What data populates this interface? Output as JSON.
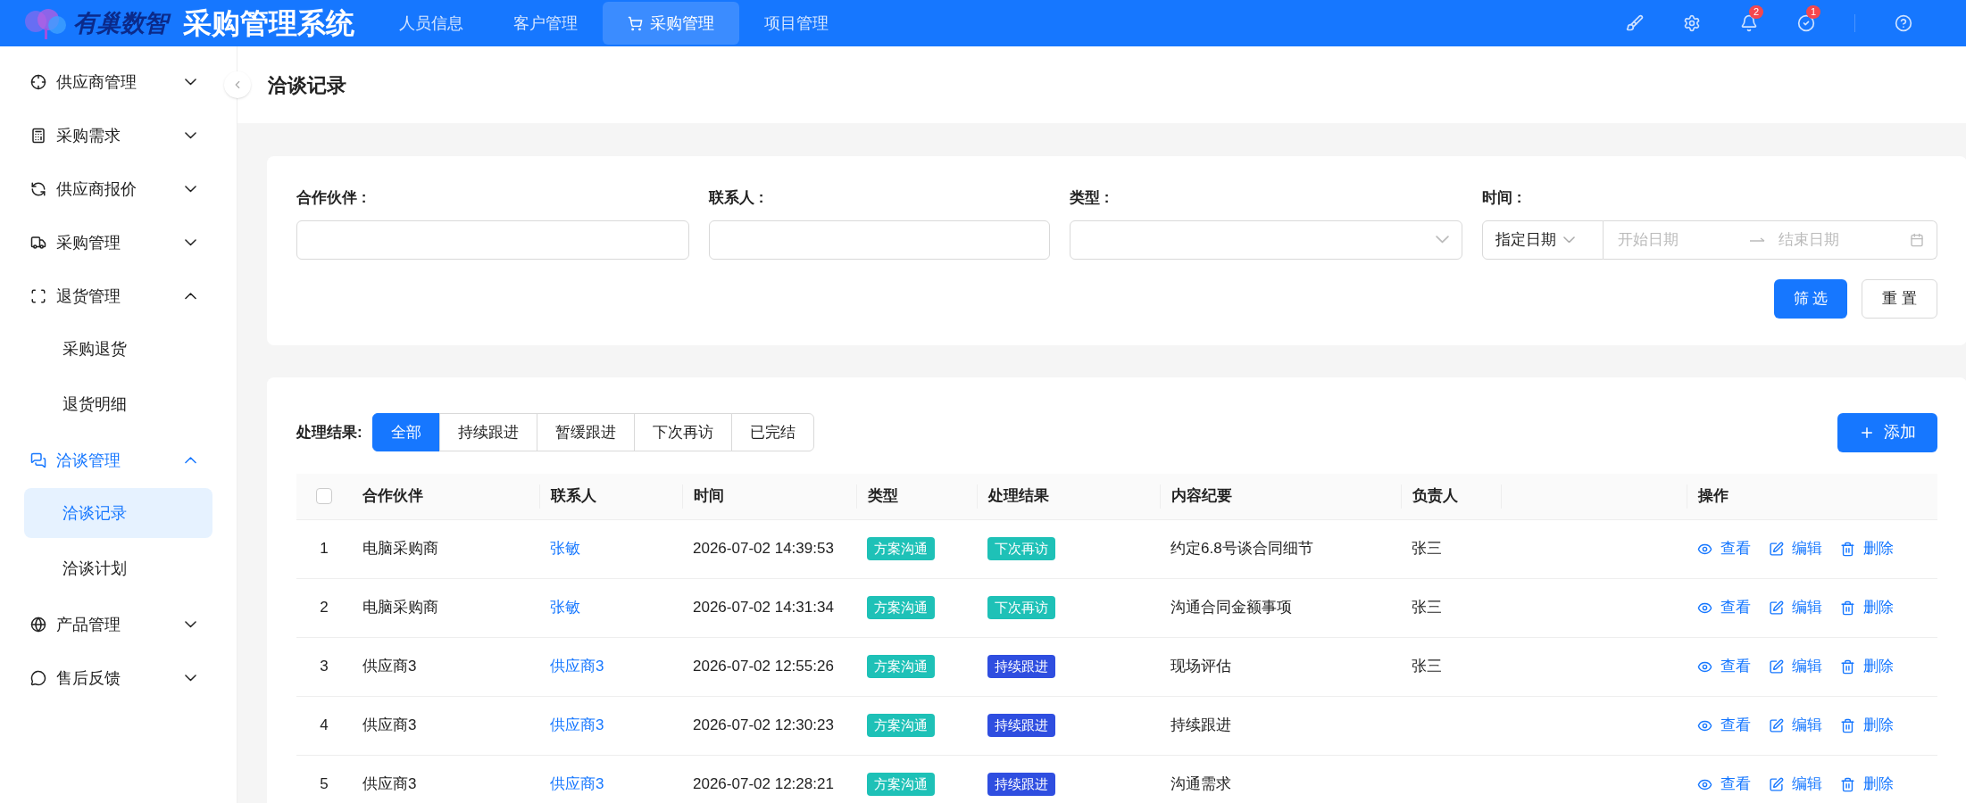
{
  "header": {
    "logo_text": "有巢数智",
    "app_title": "采购管理系统",
    "nav": [
      {
        "label": "人员信息",
        "selected": false
      },
      {
        "label": "客户管理",
        "selected": false
      },
      {
        "label": "采购管理",
        "selected": true
      },
      {
        "label": "项目管理",
        "selected": false
      }
    ],
    "badges": {
      "notifications": "2",
      "tasks": "1"
    }
  },
  "sidebar": {
    "items": [
      {
        "label": "供应商管理",
        "expanded": false
      },
      {
        "label": "采购需求",
        "expanded": false
      },
      {
        "label": "供应商报价",
        "expanded": false
      },
      {
        "label": "采购管理",
        "expanded": false
      },
      {
        "label": "退货管理",
        "expanded": true,
        "children": [
          {
            "label": "采购退货",
            "selected": false
          },
          {
            "label": "退货明细",
            "selected": false
          }
        ]
      },
      {
        "label": "洽谈管理",
        "expanded": true,
        "children": [
          {
            "label": "洽谈记录",
            "selected": true
          },
          {
            "label": "洽谈计划",
            "selected": false
          }
        ]
      },
      {
        "label": "产品管理",
        "expanded": false
      },
      {
        "label": "售后反馈",
        "expanded": false
      }
    ]
  },
  "page_title": "洽谈记录",
  "filters": {
    "fields": [
      {
        "kind": "input",
        "label": "合作伙伴 :"
      },
      {
        "kind": "input",
        "label": "联系人 :"
      },
      {
        "kind": "select",
        "label": "类型 :"
      },
      {
        "kind": "daterange",
        "label": "时间 :",
        "mode": "指定日期",
        "start_placeholder": "开始日期",
        "end_placeholder": "结束日期"
      }
    ],
    "buttons": [
      {
        "label": "筛 选",
        "primary": true
      },
      {
        "label": "重 置",
        "primary": false
      }
    ]
  },
  "results": {
    "label": "处理结果:",
    "segments": [
      {
        "label": "全部",
        "selected": true
      },
      {
        "label": "持续跟进",
        "selected": false
      },
      {
        "label": "暂缓跟进",
        "selected": false
      },
      {
        "label": "下次再访",
        "selected": false
      },
      {
        "label": "已完结",
        "selected": false
      }
    ],
    "add_button": "添加"
  },
  "table": {
    "select_all_checked": false,
    "columns": [
      "合作伙伴",
      "联系人",
      "时间",
      "类型",
      "处理结果",
      "内容纪要",
      "负责人",
      "操作"
    ],
    "rows": [
      {
        "index": "1",
        "partner": "电脑采购商",
        "contact": "张敏",
        "time": "2026-07-02 14:39:53",
        "type": {
          "label": "方案沟通",
          "color": "#1ec1b7"
        },
        "result": {
          "label": "下次再访",
          "color": "#1ec1b7"
        },
        "summary": "约定6.8号谈合同细节",
        "owner": "张三",
        "actions": [
          {
            "kind": "view",
            "label": "查看"
          },
          {
            "kind": "edit",
            "label": "编辑"
          },
          {
            "kind": "delete",
            "label": "删除"
          }
        ]
      },
      {
        "index": "2",
        "partner": "电脑采购商",
        "contact": "张敏",
        "time": "2026-07-02 14:31:34",
        "type": {
          "label": "方案沟通",
          "color": "#1ec1b7"
        },
        "result": {
          "label": "下次再访",
          "color": "#1ec1b7"
        },
        "summary": "沟通合同金额事项",
        "owner": "张三",
        "actions": [
          {
            "kind": "view",
            "label": "查看"
          },
          {
            "kind": "edit",
            "label": "编辑"
          },
          {
            "kind": "delete",
            "label": "删除"
          }
        ]
      },
      {
        "index": "3",
        "partner": "供应商3",
        "contact": "供应商3",
        "time": "2026-07-02 12:55:26",
        "type": {
          "label": "方案沟通",
          "color": "#1ec1b7"
        },
        "result": {
          "label": "持续跟进",
          "color": "#2f4ee0"
        },
        "summary": "现场评估",
        "owner": "张三",
        "actions": [
          {
            "kind": "view",
            "label": "查看"
          },
          {
            "kind": "edit",
            "label": "编辑"
          },
          {
            "kind": "delete",
            "label": "删除"
          }
        ]
      },
      {
        "index": "4",
        "partner": "供应商3",
        "contact": "供应商3",
        "time": "2026-07-02 12:30:23",
        "type": {
          "label": "方案沟通",
          "color": "#1ec1b7"
        },
        "result": {
          "label": "持续跟进",
          "color": "#2f4ee0"
        },
        "summary": "持续跟进",
        "actions": [
          {
            "kind": "view",
            "label": "查看"
          },
          {
            "kind": "edit",
            "label": "编辑"
          },
          {
            "kind": "delete",
            "label": "删除"
          }
        ]
      },
      {
        "index": "5",
        "partner": "供应商3",
        "contact": "供应商3",
        "time": "2026-07-02 12:28:21",
        "type": {
          "label": "方案沟通",
          "color": "#1ec1b7"
        },
        "result": {
          "label": "持续跟进",
          "color": "#2f4ee0"
        },
        "summary": "沟通需求",
        "actions": [
          {
            "kind": "view",
            "label": "查看"
          },
          {
            "kind": "edit",
            "label": "编辑"
          },
          {
            "kind": "delete",
            "label": "删除"
          }
        ]
      }
    ]
  }
}
